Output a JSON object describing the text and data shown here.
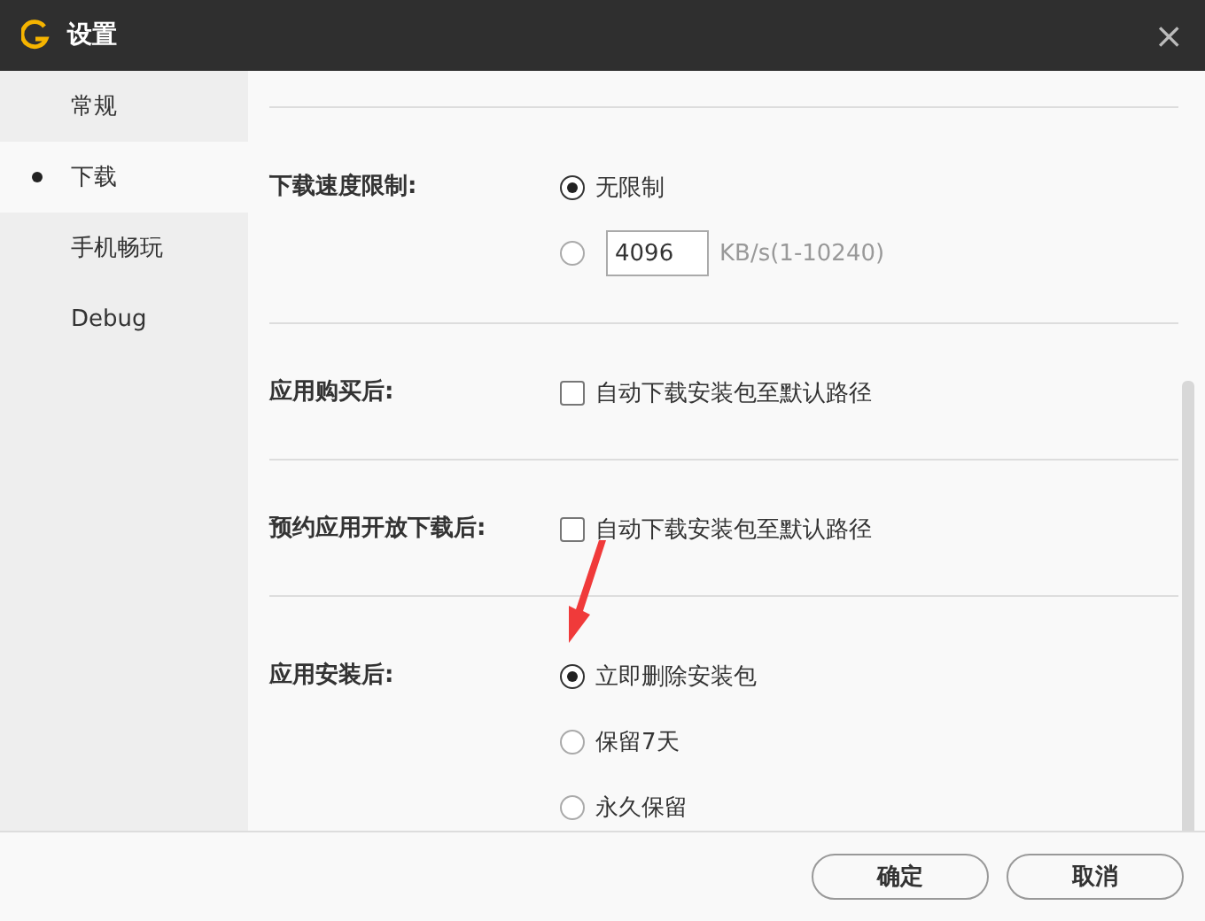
{
  "window": {
    "title": "设置",
    "close": "×"
  },
  "sidebar": {
    "items": [
      {
        "label": "常规",
        "selected": false
      },
      {
        "label": "下载",
        "selected": true
      },
      {
        "label": "手机畅玩",
        "selected": false
      },
      {
        "label": "Debug",
        "selected": false
      }
    ]
  },
  "sections": [
    {
      "label": "下载速度限制:",
      "kind": "radio",
      "options": [
        {
          "label": "无限制",
          "selected": true
        },
        {
          "selected": false,
          "input": "4096",
          "unit": "KB/s(1-10240)"
        }
      ]
    },
    {
      "label": "应用购买后:",
      "kind": "checkbox",
      "checkbox": {
        "label": "自动下载安装包至默认路径",
        "checked": false
      }
    },
    {
      "label": "预约应用开放下载后:",
      "kind": "checkbox",
      "checkbox": {
        "label": "自动下载安装包至默认路径",
        "checked": false
      }
    },
    {
      "label": "应用安装后:",
      "kind": "radio",
      "annotated": true,
      "options": [
        {
          "label": "立即删除安装包",
          "selected": true
        },
        {
          "label": "保留7天",
          "selected": false
        },
        {
          "label": "永久保留",
          "selected": false
        }
      ]
    }
  ],
  "buttons": [
    "确定",
    "取消"
  ]
}
